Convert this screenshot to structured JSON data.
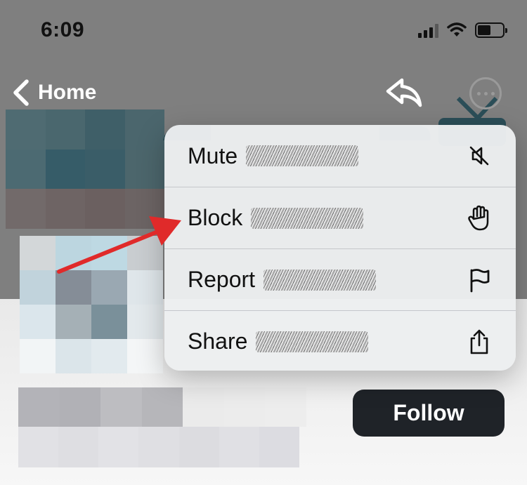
{
  "status_bar": {
    "time": "6:09"
  },
  "nav": {
    "back_label": "Home",
    "icons": {
      "back": "chevron-left-icon",
      "reply": "reply-icon",
      "more": "more-icon"
    }
  },
  "menu": {
    "items": [
      {
        "label": "Mute",
        "icon": "speaker-muted-icon"
      },
      {
        "label": "Block",
        "icon": "hand-icon"
      },
      {
        "label": "Report",
        "icon": "flag-icon"
      },
      {
        "label": "Share",
        "icon": "share-icon"
      }
    ]
  },
  "profile": {
    "follow_label": "Follow"
  },
  "colors": {
    "accent_dark": "#1f2328",
    "arrow_red": "#e02a2a",
    "menu_bg": "#eceef0"
  }
}
